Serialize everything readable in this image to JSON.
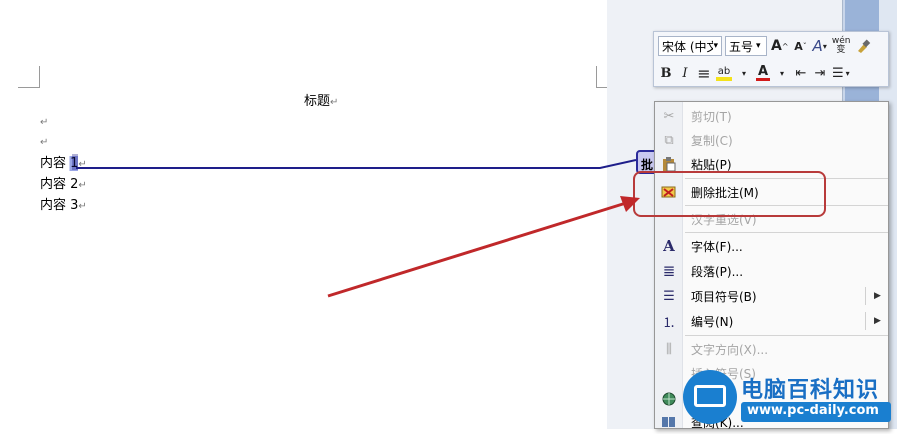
{
  "document": {
    "title": "标题",
    "paragraph_mark": "↵",
    "lines": [
      "内容 1",
      "内容 2",
      "内容 3"
    ]
  },
  "comment": {
    "tag": "批"
  },
  "mini_toolbar": {
    "font_name": "宋体 (中文",
    "font_size": "五号",
    "grow_font": "A",
    "shrink_font": "A",
    "style": "A",
    "phonetic": "wén 变",
    "bold": "B",
    "italic": "I",
    "center": "≡",
    "highlight": "ab",
    "font_color": "A",
    "decrease_indent": "⇤",
    "increase_indent": "⇥",
    "bullets": "☰",
    "dropdown": "▾",
    "colors": {
      "highlight_yellow": "#f4e21a",
      "font_red": "#d11a1a"
    }
  },
  "context_menu": {
    "items": [
      {
        "label": "剪切(T)",
        "icon": "scissors-icon",
        "glyph": "✂",
        "disabled": true
      },
      {
        "label": "复制(C)",
        "icon": "copy-icon",
        "glyph": "⧉",
        "disabled": true
      },
      {
        "label": "粘贴(P)",
        "icon": "paste-icon",
        "glyph": "📋",
        "disabled": false
      },
      {
        "label": "删除批注(M)",
        "icon": "delete-comment-icon",
        "glyph": "✉",
        "disabled": false
      },
      {
        "label": "汉字重选(V)",
        "icon": "",
        "glyph": "",
        "disabled": true
      },
      {
        "label": "字体(F)...",
        "icon": "font-icon",
        "glyph": "A",
        "disabled": false
      },
      {
        "label": "段落(P)...",
        "icon": "paragraph-icon",
        "glyph": "≣",
        "disabled": false
      },
      {
        "label": "项目符号(B)",
        "icon": "bullets-icon",
        "glyph": "☰",
        "disabled": false,
        "submenu": true
      },
      {
        "label": "编号(N)",
        "icon": "numbering-icon",
        "glyph": "⒈",
        "disabled": false,
        "submenu": true
      },
      {
        "label": "文字方向(X)...",
        "icon": "text-direction-icon",
        "glyph": "⫼",
        "disabled": true
      },
      {
        "label": "插入符号(S)",
        "icon": "",
        "glyph": "",
        "disabled": true
      },
      {
        "label": "",
        "icon": "hyperlink-icon",
        "glyph": "🌐",
        "disabled": false
      },
      {
        "label": "查阅(K)...",
        "icon": "lookup-icon",
        "glyph": "📖",
        "disabled": false
      }
    ],
    "submenu_arrow": "▶"
  },
  "watermark": {
    "title": "电脑百科知识",
    "url": "www.pc-daily.com"
  },
  "colors": {
    "arrow": "#c0282a",
    "highlight_box": "#b83a3a",
    "comment_line": "#1e1e8a"
  }
}
